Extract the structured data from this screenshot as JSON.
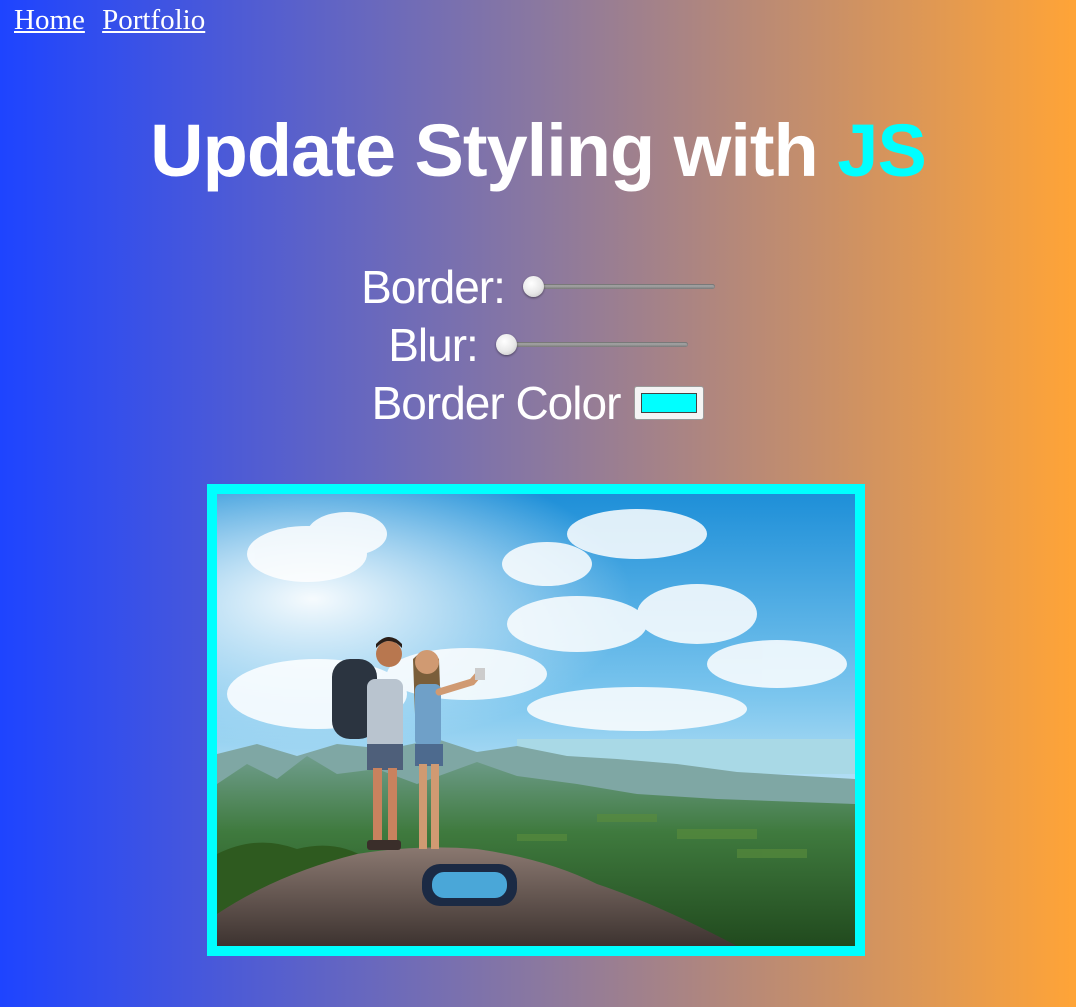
{
  "nav": {
    "home_label": "Home",
    "portfolio_label": "Portfolio"
  },
  "header": {
    "title_main": "Update Styling with",
    "title_highlight": "JS"
  },
  "controls": {
    "border_label": "Border:",
    "border_value": 0,
    "blur_label": "Blur:",
    "blur_value": 0,
    "color_label": "Border Color",
    "color_value": "#00ffff"
  },
  "colors": {
    "accent": "#00ffff",
    "gradient_start": "#1e44ff",
    "gradient_end": "#ffa437"
  },
  "image": {
    "alt": "Two hikers on a mountain peak overlooking a valley and sea"
  }
}
